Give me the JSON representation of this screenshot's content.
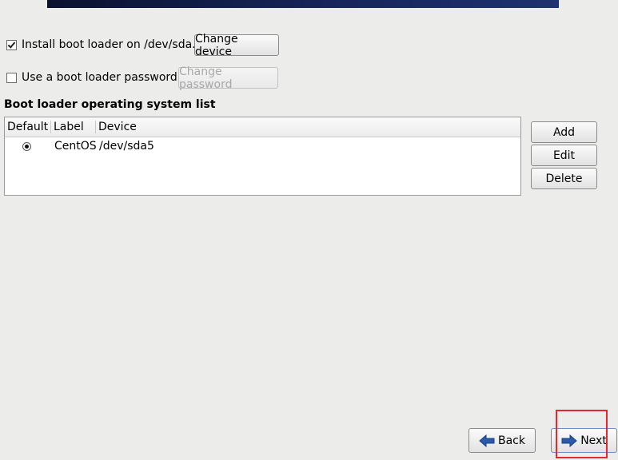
{
  "boot_loader": {
    "install_checkbox": {
      "label": "Install boot loader on /dev/sda.",
      "checked": true
    },
    "change_device_label": "Change device",
    "password_checkbox": {
      "label": "Use a boot loader password",
      "checked": false
    },
    "change_password_label": "Change password"
  },
  "os_list": {
    "title": "Boot loader operating system list",
    "columns": [
      "Default",
      "Label",
      "Device"
    ],
    "rows": [
      {
        "default": true,
        "label": "CentOS",
        "device": "/dev/sda5"
      }
    ],
    "buttons": {
      "add": "Add",
      "edit": "Edit",
      "delete": "Delete"
    }
  },
  "nav": {
    "back_label": "Back",
    "next_label": "Next"
  },
  "colors": {
    "banner": "#17255a",
    "highlight": "#e8262b",
    "arrow": "#2a5aa8"
  },
  "icons": {
    "back": "arrow-left-icon",
    "next": "arrow-right-icon"
  }
}
